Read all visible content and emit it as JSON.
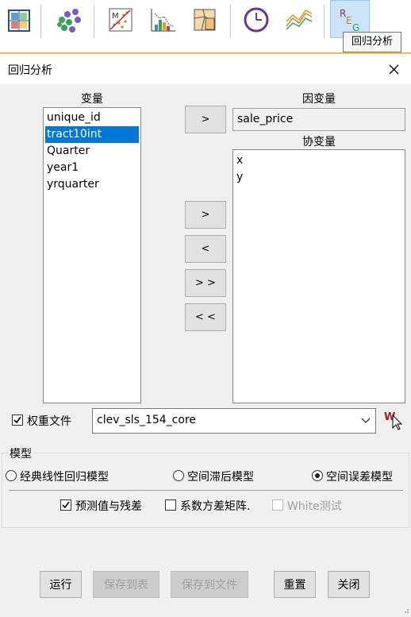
{
  "toolbar": {
    "buttons": [
      {
        "icon": "map-grid-icon"
      },
      {
        "icon": "cluster-icon"
      },
      {
        "icon": "scatter-matrix-icon"
      },
      {
        "icon": "histogram-icon"
      },
      {
        "icon": "cartogram-icon"
      },
      {
        "icon": "clock-icon"
      },
      {
        "icon": "parallel-coordinates-icon"
      },
      {
        "icon": "regression-icon"
      }
    ],
    "tooltip": "回归分析"
  },
  "dialog": {
    "title": "回归分析",
    "variables_label": "变量",
    "variables": [
      "unique_id",
      "tract10int",
      "Quarter",
      "year1",
      "yrquarter"
    ],
    "selected_variable": "tract10int",
    "dependent_label": "因变量",
    "dependent_value": "sale_price",
    "covariates_label": "协变量",
    "covariates": [
      "x",
      "y"
    ],
    "buttons": {
      "add_dep": ">",
      "add": ">",
      "remove": "<",
      "add_all": "> >",
      "remove_all": "< <"
    },
    "weights": {
      "label": "权重文件",
      "checked": true,
      "value": "clev_sls_154_core"
    },
    "model": {
      "label": "模型",
      "options": [
        "经典线性回归模型",
        "空间滞后模型",
        "空间误差模型"
      ],
      "selected": "空间误差模型"
    },
    "options": {
      "predicted": "预测值与残差",
      "coef_var": "系数方差矩阵.",
      "white": "White测试"
    },
    "footer": {
      "run": "运行",
      "save_table": "保存到表",
      "save_file": "保存到文件",
      "reset": "重置",
      "close": "关闭"
    },
    "colors": {
      "selection": "#0078d7",
      "toolbar_accent": "#e8c44a"
    }
  }
}
